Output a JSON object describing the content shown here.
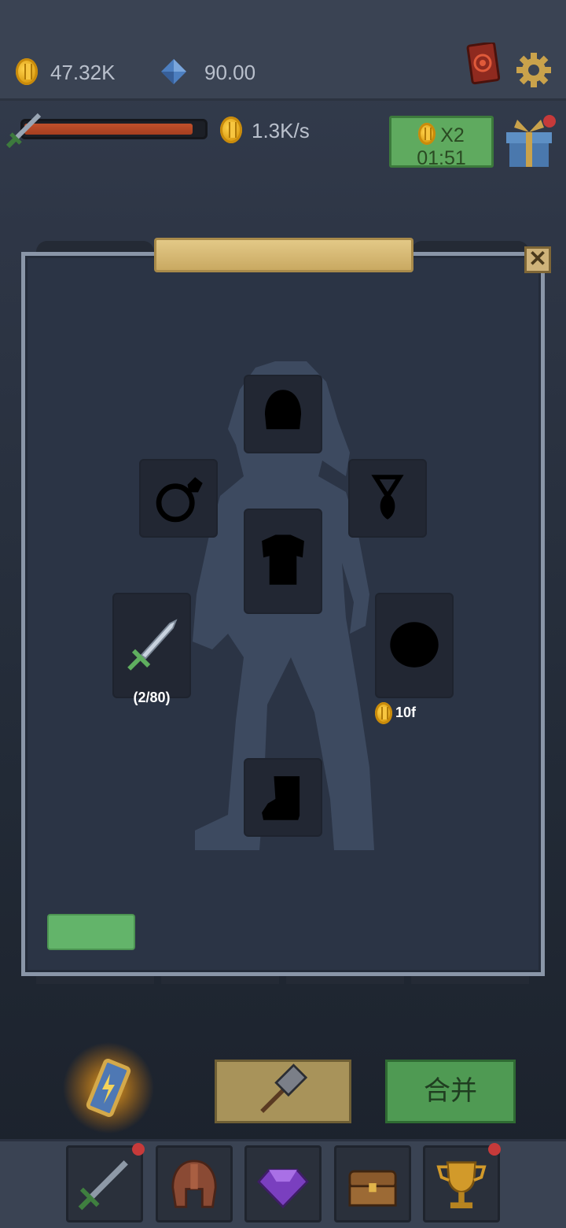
{
  "currencies": {
    "gold": "47.32K",
    "gems": "90.00"
  },
  "income": {
    "rate": "1.3K/s",
    "progress_fraction": 0.94
  },
  "boost": {
    "multiplier": "X2",
    "timer": "01:51"
  },
  "equipment": {
    "weapon_count": "(2/80)",
    "shield_cost": "10f"
  },
  "actions": {
    "merge_label": "合并"
  },
  "icons": {
    "top_left": [
      "gold-coin-icon",
      "gem-icon"
    ],
    "top_right": [
      "spell-book-icon",
      "settings-gear-icon"
    ],
    "gift": "gift-box-icon",
    "nav": [
      "sword-icon",
      "helmet-icon",
      "purple-gem-icon",
      "treasure-chest-icon",
      "trophy-icon"
    ]
  },
  "colors": {
    "accent_green": "#5faa5f",
    "gold_plate": "#d8bd7b",
    "badge_red": "#c63a3a"
  }
}
